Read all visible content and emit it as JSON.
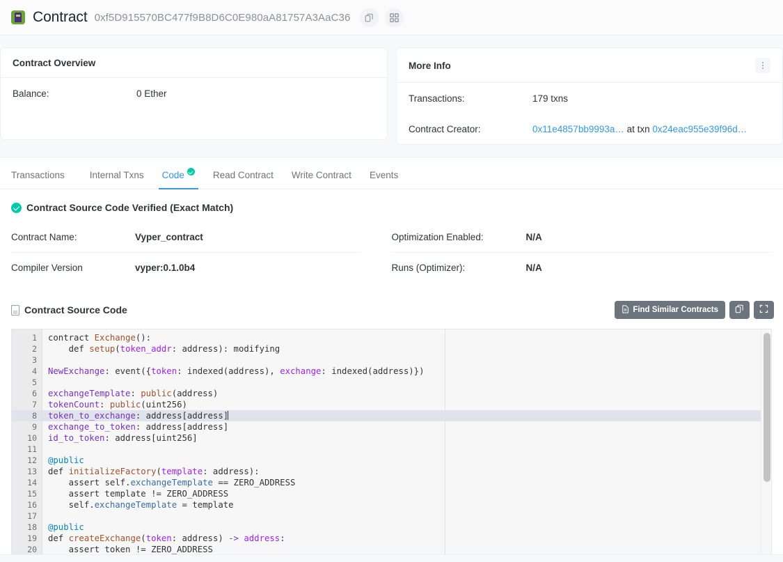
{
  "header": {
    "logo_icon": "etherscan-logo-icon",
    "title": "Contract",
    "address": "0xf5D915570BC477f9B8D6C0E980aA81757A3AaC36",
    "copy_icon": "copy-icon",
    "qr_icon": "qr-code-icon"
  },
  "contract_overview": {
    "title": "Contract Overview",
    "rows": [
      {
        "key": "Balance:",
        "value": "0 Ether"
      }
    ]
  },
  "more_info": {
    "title": "More Info",
    "menu_icon": "kebab-menu-icon",
    "rows": [
      {
        "key": "Transactions:",
        "value": "179 txns"
      }
    ],
    "creator_key": "Contract Creator:",
    "creator_address": "0x11e4857bb9993a…",
    "creator_sep": " at txn ",
    "creator_txn": "0x24eac955e39f96d…"
  },
  "tabs": [
    {
      "label": "Transactions",
      "active": false,
      "verified": false
    },
    {
      "label": "Internal Txns",
      "active": false,
      "verified": false
    },
    {
      "label": "Code",
      "active": true,
      "verified": true
    },
    {
      "label": "Read Contract",
      "active": false,
      "verified": false
    },
    {
      "label": "Write Contract",
      "active": false,
      "verified": false
    },
    {
      "label": "Events",
      "active": false,
      "verified": false
    }
  ],
  "verified_banner": {
    "icon": "verified-check-icon",
    "text": "Contract Source Code Verified (Exact Match)"
  },
  "meta_left": [
    {
      "key": "Contract Name:",
      "value": "Vyper_contract"
    },
    {
      "key": "Compiler Version",
      "value": "vyper:0.1.0b4"
    }
  ],
  "meta_right": [
    {
      "key": "Optimization Enabled:",
      "value": "N/A"
    },
    {
      "key": "Runs (Optimizer):",
      "value": "N/A"
    }
  ],
  "source_section": {
    "file_icon": "source-file-icon",
    "title": "Contract Source Code",
    "find_similar_label": "Find Similar Contracts",
    "find_similar_icon": "document-icon",
    "copy_icon": "copy-icon",
    "expand_icon": "fullscreen-icon"
  },
  "editor": {
    "active_line": 8,
    "first_line": 1,
    "last_line": 20,
    "scroll_thumb_top_pct": 1.5,
    "scroll_thumb_height_pct": 66,
    "lines": [
      {
        "n": 1,
        "tokens": [
          {
            "t": "contract ",
            "c": "plain"
          },
          {
            "t": "Exchange",
            "c": "fn"
          },
          {
            "t": "():",
            "c": "plain"
          }
        ]
      },
      {
        "n": 2,
        "tokens": [
          {
            "t": "    def ",
            "c": "plain"
          },
          {
            "t": "setup",
            "c": "fn"
          },
          {
            "t": "(",
            "c": "plain"
          },
          {
            "t": "token_addr",
            "c": "arg"
          },
          {
            "t": ": address): modifying",
            "c": "plain"
          }
        ]
      },
      {
        "n": 3,
        "tokens": []
      },
      {
        "n": 4,
        "tokens": [
          {
            "t": "NewExchange",
            "c": "kw"
          },
          {
            "t": ": event({",
            "c": "plain"
          },
          {
            "t": "token",
            "c": "arg"
          },
          {
            "t": ": indexed(address), ",
            "c": "plain"
          },
          {
            "t": "exchange",
            "c": "arg"
          },
          {
            "t": ": indexed(address)})",
            "c": "plain"
          }
        ]
      },
      {
        "n": 5,
        "tokens": []
      },
      {
        "n": 6,
        "tokens": [
          {
            "t": "exchangeTemplate",
            "c": "kw"
          },
          {
            "t": ": ",
            "c": "plain"
          },
          {
            "t": "public",
            "c": "fn"
          },
          {
            "t": "(address)",
            "c": "plain"
          }
        ]
      },
      {
        "n": 7,
        "tokens": [
          {
            "t": "tokenCount",
            "c": "kw"
          },
          {
            "t": ": ",
            "c": "plain"
          },
          {
            "t": "public",
            "c": "fn"
          },
          {
            "t": "(uint256)",
            "c": "plain"
          }
        ]
      },
      {
        "n": 8,
        "tokens": [
          {
            "t": "token_to_exchange",
            "c": "kw"
          },
          {
            "t": ": address[address]",
            "c": "plain"
          }
        ],
        "caret": true
      },
      {
        "n": 9,
        "tokens": [
          {
            "t": "exchange_to_token",
            "c": "kw"
          },
          {
            "t": ": address[address]",
            "c": "plain"
          }
        ]
      },
      {
        "n": 10,
        "tokens": [
          {
            "t": "id_to_token",
            "c": "kw"
          },
          {
            "t": ": address[uint256]",
            "c": "plain"
          }
        ]
      },
      {
        "n": 11,
        "tokens": []
      },
      {
        "n": 12,
        "tokens": [
          {
            "t": "@public",
            "c": "dec"
          }
        ]
      },
      {
        "n": 13,
        "tokens": [
          {
            "t": "def ",
            "c": "plain"
          },
          {
            "t": "initializeFactory",
            "c": "fn"
          },
          {
            "t": "(",
            "c": "plain"
          },
          {
            "t": "template",
            "c": "arg"
          },
          {
            "t": ": address):",
            "c": "plain"
          }
        ]
      },
      {
        "n": 14,
        "tokens": [
          {
            "t": "    assert ",
            "c": "plain"
          },
          {
            "t": "self",
            "c": "plain"
          },
          {
            "t": ".",
            "c": "plain"
          },
          {
            "t": "exchangeTemplate",
            "c": "self"
          },
          {
            "t": " == ZERO_ADDRESS",
            "c": "plain"
          }
        ]
      },
      {
        "n": 15,
        "tokens": [
          {
            "t": "    assert template ",
            "c": "plain"
          },
          {
            "t": "!=",
            "c": "plain"
          },
          {
            "t": " ZERO_ADDRESS",
            "c": "plain"
          }
        ]
      },
      {
        "n": 16,
        "tokens": [
          {
            "t": "    self.",
            "c": "plain"
          },
          {
            "t": "exchangeTemplate",
            "c": "self"
          },
          {
            "t": " = template",
            "c": "plain"
          }
        ]
      },
      {
        "n": 17,
        "tokens": []
      },
      {
        "n": 18,
        "tokens": [
          {
            "t": "@public",
            "c": "dec"
          }
        ]
      },
      {
        "n": 19,
        "tokens": [
          {
            "t": "def ",
            "c": "plain"
          },
          {
            "t": "createExchange",
            "c": "fn"
          },
          {
            "t": "(",
            "c": "plain"
          },
          {
            "t": "token",
            "c": "arg"
          },
          {
            "t": ": address) ",
            "c": "plain"
          },
          {
            "t": "->",
            "c": "kw"
          },
          {
            "t": " ",
            "c": "plain"
          },
          {
            "t": "address",
            "c": "arg"
          },
          {
            "t": ":",
            "c": "plain"
          }
        ]
      },
      {
        "n": 20,
        "tokens": [
          {
            "t": "    assert token ",
            "c": "plain"
          },
          {
            "t": "!=",
            "c": "plain"
          },
          {
            "t": " ZERO_ADDRESS",
            "c": "plain"
          }
        ]
      }
    ]
  },
  "colors": {
    "link": "#3498db",
    "verified": "#00c9a7",
    "muted": "#6c757d",
    "text": "#2e3338",
    "active_line": "#dee3ec"
  }
}
